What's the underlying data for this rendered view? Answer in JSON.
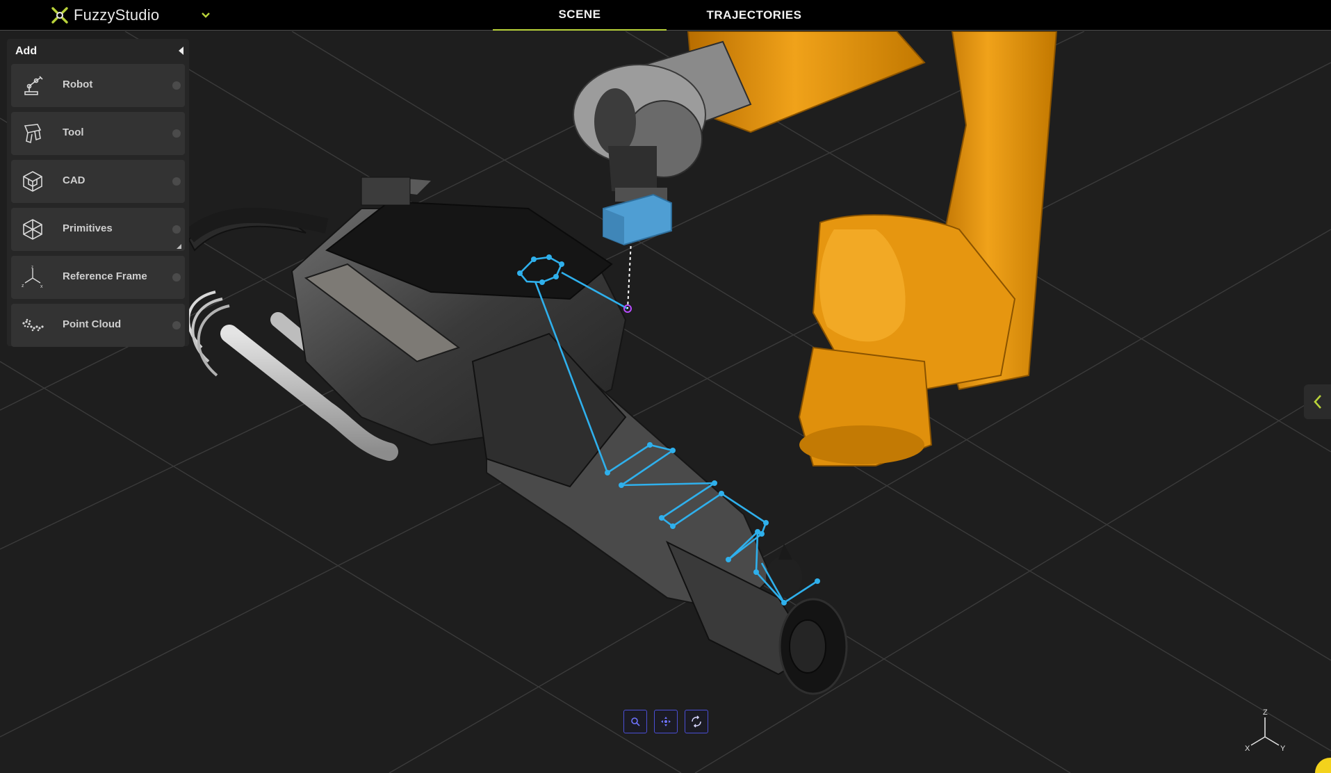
{
  "header": {
    "brand": "FuzzyStudio",
    "tabs": [
      {
        "label": "SCENE",
        "active": true
      },
      {
        "label": "TRAJECTORIES",
        "active": false
      }
    ],
    "accent": "#b9d33a"
  },
  "add_panel": {
    "title": "Add",
    "items": [
      {
        "label": "Robot",
        "icon": "robot-icon"
      },
      {
        "label": "Tool",
        "icon": "tool-icon"
      },
      {
        "label": "CAD",
        "icon": "cad-cube-icon"
      },
      {
        "label": "Primitives",
        "icon": "primitives-icon"
      },
      {
        "label": "Reference Frame",
        "icon": "reference-frame-icon"
      },
      {
        "label": "Point Cloud",
        "icon": "point-cloud-icon"
      }
    ]
  },
  "viewport": {
    "robot_color": "#e8980e",
    "trajectory_color": "#2fb0ec",
    "axis_labels": {
      "z": "Z",
      "x": "X",
      "y": "Y"
    }
  },
  "toolbar": {
    "tools": [
      "zoom-icon",
      "pan-icon",
      "rotate-icon"
    ],
    "color": "#4b4fd6"
  }
}
